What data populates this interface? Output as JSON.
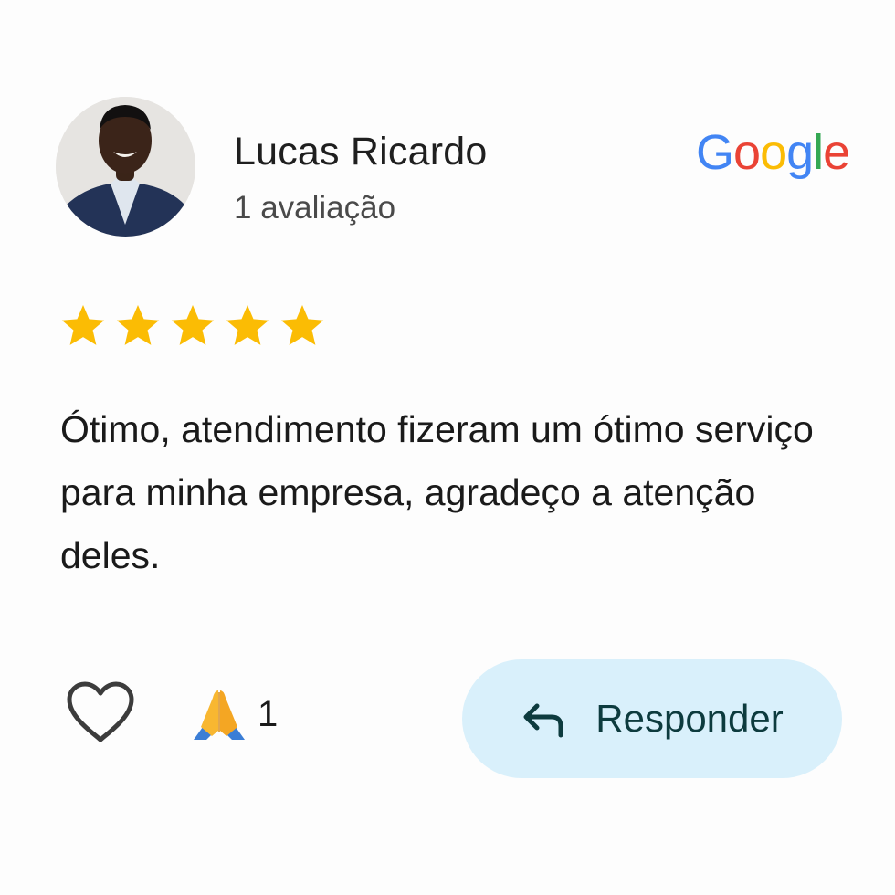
{
  "reviewer": {
    "name": "Lucas Ricardo",
    "review_count": "1 avaliação",
    "avatar_icon": "avatar-photo"
  },
  "brand": {
    "letters": [
      "G",
      "o",
      "o",
      "g",
      "l",
      "e"
    ],
    "colors": [
      "#4285F4",
      "#EA4335",
      "#FBBC05",
      "#4285F4",
      "#34A853",
      "#EA4335"
    ]
  },
  "rating": {
    "stars": 5,
    "max": 5,
    "color": "#FBBC04"
  },
  "review": {
    "text": "Ótimo, atendimento fizeram um ótimo serviço para minha empresa, agradeço a atenção deles."
  },
  "actions": {
    "like_icon": "heart-outline-icon",
    "reaction_icon": "folded-hands-emoji",
    "reaction_count": "1",
    "reply_icon": "reply-arrow-icon",
    "reply_label": "Responder",
    "reply_bg": "#d9f0fb"
  }
}
